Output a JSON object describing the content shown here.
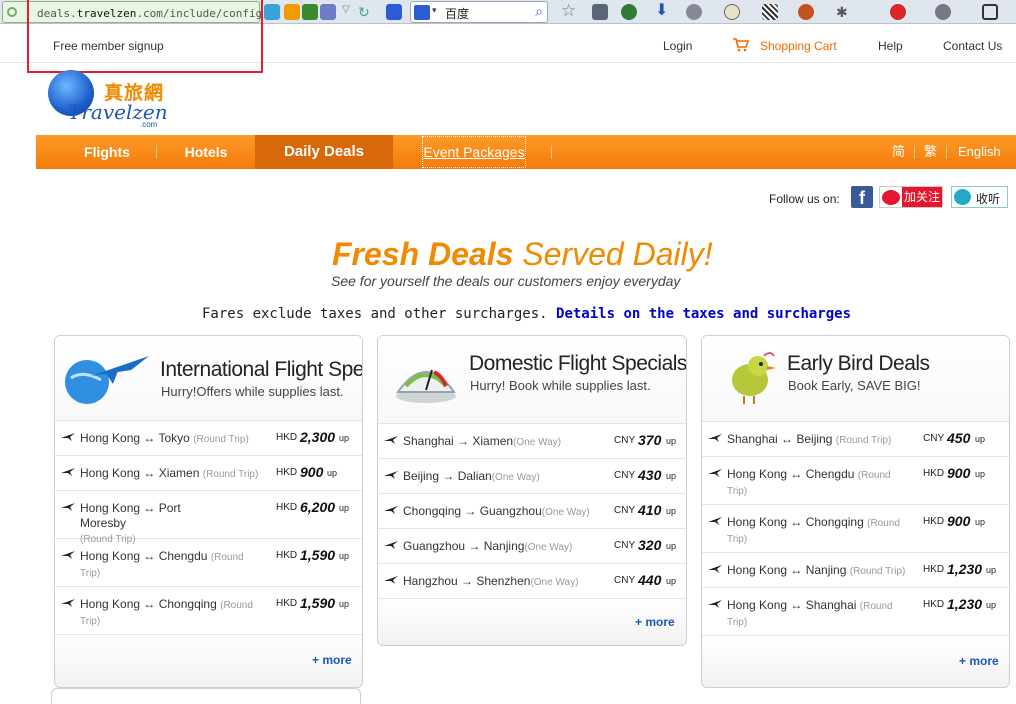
{
  "browser": {
    "url_prefix": "deals.",
    "url_host": "travelzen",
    "url_rest": ".com/include/config",
    "search_query": "百度"
  },
  "top": {
    "signup": "Free member signup",
    "login": "Login",
    "cart": "Shopping Cart",
    "help": "Help",
    "contact": "Contact Us"
  },
  "logo": {
    "cn": "真旅網",
    "brand": "Travelzen",
    "dotcom": ".com"
  },
  "nav": {
    "items": [
      "Flights",
      "Hotels",
      "Daily Deals",
      "Event Packages"
    ],
    "active": "Daily Deals",
    "lang": [
      "简",
      "繁",
      "English"
    ]
  },
  "follow": {
    "label": "Follow us on:",
    "weibo": "加关注",
    "qq": "收听"
  },
  "headline": {
    "bold": "Fresh Deals",
    "light": " Served Daily!",
    "sub": "See for yourself the deals our customers enjoy everyday"
  },
  "fares": {
    "text": "Fares exclude taxes and other surcharges. ",
    "link": "Details on the taxes and surcharges"
  },
  "cards": [
    {
      "title": "International Flight Specials",
      "sub": "Hurry!Offers while supplies last.",
      "currency": "HKD",
      "deals": [
        {
          "route": "Hong Kong ↔ Tokyo",
          "trip": "(Round Trip)",
          "price": "2,300"
        },
        {
          "route": "Hong Kong ↔ Xiamen",
          "trip": "(Round Trip)",
          "price": "900"
        },
        {
          "route": "Hong Kong ↔ Port Moresby",
          "trip": "(Round Trip)",
          "price": "6,200"
        },
        {
          "route": "Hong Kong ↔ Chengdu",
          "trip": "(Round Trip)",
          "price": "1,590"
        },
        {
          "route": "Hong Kong ↔ Chongqing",
          "trip": "(Round Trip)",
          "price": "1,590"
        }
      ],
      "more": "+ more"
    },
    {
      "title": "Domestic Flight Specials",
      "sub": "Hurry! Book while supplies last.",
      "currency": "CNY",
      "deals": [
        {
          "route": "Shanghai → Xiamen",
          "trip": "(One Way)",
          "price": "370"
        },
        {
          "route": "Beijing → Dalian",
          "trip": "(One Way)",
          "price": "430"
        },
        {
          "route": "Chongqing → Guangzhou",
          "trip": "(One Way)",
          "price": "410"
        },
        {
          "route": "Guangzhou → Nanjing",
          "trip": "(One Way)",
          "price": "320"
        },
        {
          "route": "Hangzhou → Shenzhen",
          "trip": "(One Way)",
          "price": "440"
        }
      ],
      "more": "+ more"
    },
    {
      "title": "Early Bird Deals",
      "sub": "Book Early, SAVE BIG!",
      "currency": "CNY",
      "currency_alt": "HKD",
      "deals": [
        {
          "route": "Shanghai ↔ Beijing",
          "trip": "(Round Trip)",
          "price": "450",
          "cur": "CNY"
        },
        {
          "route": "Hong Kong ↔ Chengdu",
          "trip": "(Round Trip)",
          "price": "900",
          "cur": "HKD"
        },
        {
          "route": "Hong Kong ↔ Chongqing",
          "trip": "(Round Trip)",
          "price": "900",
          "cur": "HKD"
        },
        {
          "route": "Hong Kong ↔ Nanjing",
          "trip": "(Round Trip)",
          "price": "1,230",
          "cur": "HKD"
        },
        {
          "route": "Hong Kong ↔ Shanghai",
          "trip": "(Round Trip)",
          "price": "1,230",
          "cur": "HKD"
        }
      ],
      "more": "+ more"
    }
  ],
  "price_suffix": "up"
}
